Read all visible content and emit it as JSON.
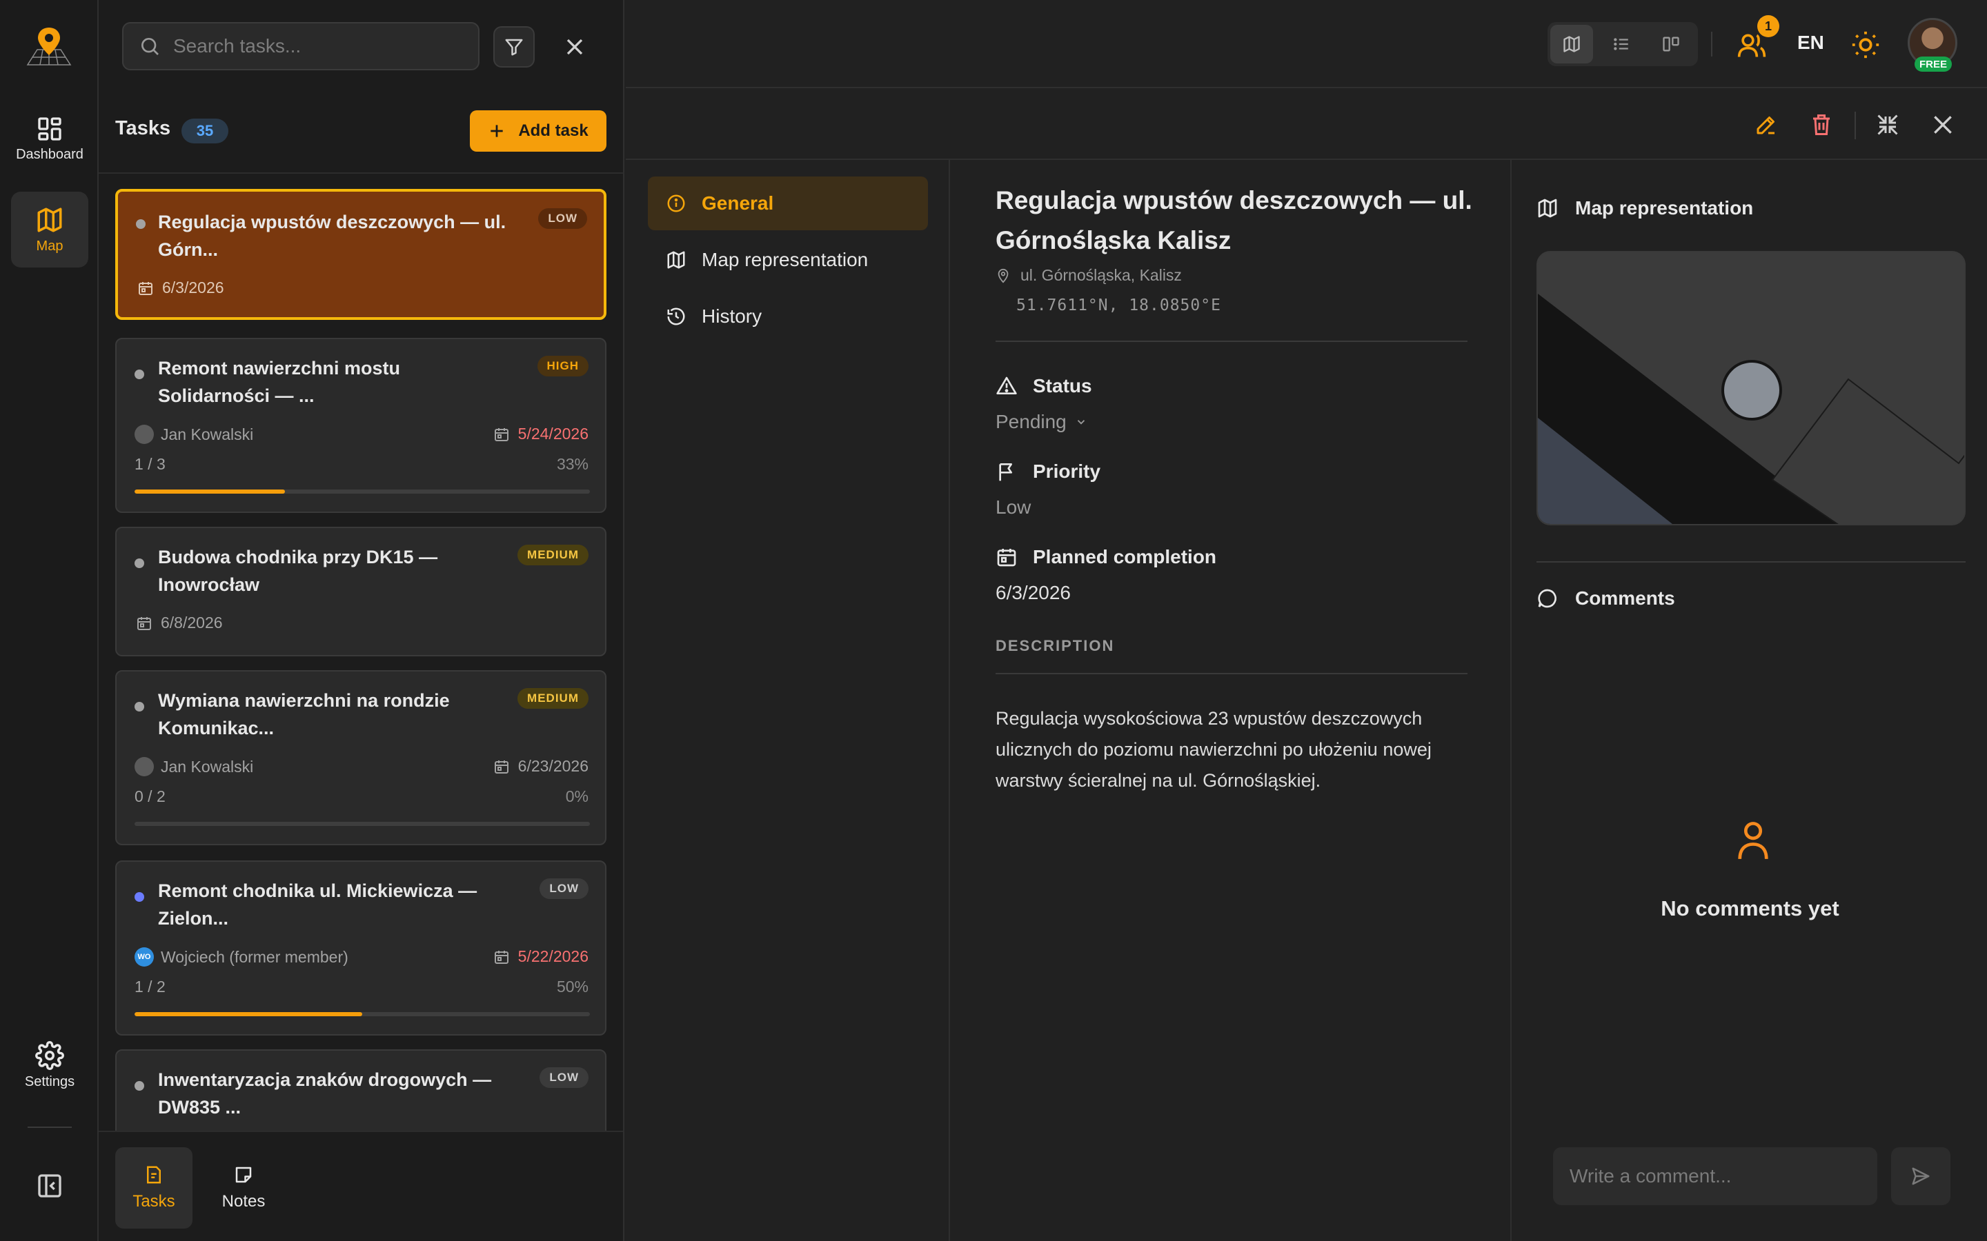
{
  "rail": {
    "items": [
      {
        "label": "Dashboard",
        "icon": "dashboard-icon"
      },
      {
        "label": "Map",
        "icon": "map-icon"
      },
      {
        "label": "Settings",
        "icon": "gear-icon"
      }
    ]
  },
  "task_panel": {
    "search_placeholder": "Search tasks...",
    "title": "Tasks",
    "count": "35",
    "add_label": "Add task",
    "tasks": [
      {
        "title": "Regulacja wpustów deszczowych — ul. Górn...",
        "priority": "LOW",
        "date": "6/3/2026",
        "selected": true
      },
      {
        "title": "Remont nawierzchni mostu Solidarności — ...",
        "priority": "HIGH",
        "assignee": "Jan Kowalski",
        "date": "5/24/2026",
        "overdue": true,
        "progress_text": "1 / 3",
        "progress_pct": "33%",
        "progress": 0.33
      },
      {
        "title": "Budowa chodnika przy DK15 — Inowrocław",
        "priority": "MEDIUM",
        "date": "6/8/2026"
      },
      {
        "title": "Wymiana nawierzchni na rondzie Komunikac...",
        "priority": "MEDIUM",
        "assignee": "Jan Kowalski",
        "date": "6/23/2026",
        "progress_text": "0 / 2",
        "progress_pct": "0%",
        "progress": 0
      },
      {
        "title": "Remont chodnika ul. Mickiewicza — Zielon...",
        "priority": "LOW",
        "assignee": "Wojciech (former member)",
        "assignee_initials": "WO",
        "date": "5/22/2026",
        "overdue": true,
        "progress_text": "1 / 2",
        "progress_pct": "50%",
        "progress": 0.5
      },
      {
        "title": "Inwentaryzacja znaków drogowych — DW835 ...",
        "priority": "LOW"
      }
    ],
    "bottom_tabs": [
      {
        "label": "Tasks",
        "icon": "tasks-icon"
      },
      {
        "label": "Notes",
        "icon": "notes-icon"
      }
    ]
  },
  "topbar": {
    "members_count": "1",
    "language": "EN",
    "plan_badge": "FREE"
  },
  "detail": {
    "nav": [
      {
        "label": "General",
        "icon": "info-icon"
      },
      {
        "label": "Map representation",
        "icon": "map-icon"
      },
      {
        "label": "History",
        "icon": "history-icon"
      }
    ],
    "title": "Regulacja wpustów deszczowych — ul. Górnośląska Kalisz",
    "address": "ul. Górnośląska, Kalisz",
    "coords": "51.7611°N, 18.0850°E",
    "status_label": "Status",
    "status_value": "Pending",
    "priority_label": "Priority",
    "priority_value": "Low",
    "planned_label": "Planned completion",
    "planned_value": "6/3/2026",
    "description_label": "DESCRIPTION",
    "description": "Regulacja wysokościowa 23 wpustów deszczowych ulicznych do poziomu nawierzchni po ułożeniu nowej warstwy ścieralnej na ul. Górnośląskiej."
  },
  "right": {
    "map_heading": "Map representation",
    "comments_heading": "Comments",
    "no_comments": "No comments yet",
    "comment_placeholder": "Write a comment..."
  },
  "colors": {
    "accent": "#f59e0b",
    "selected_card": "#7a380e",
    "overdue": "#f87171",
    "background": "#212121"
  }
}
